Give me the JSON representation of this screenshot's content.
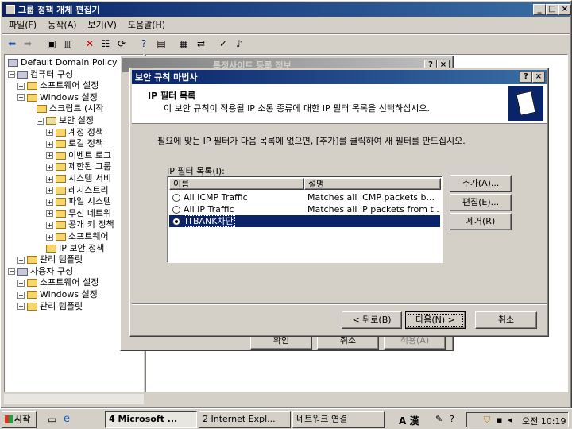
{
  "main_window": {
    "title": "그룹 정책 개체 편집기",
    "menu": [
      "파일(F)",
      "동작(A)",
      "보기(V)",
      "도움말(H)"
    ],
    "tree": [
      {
        "label": "Default Domain Policy [I",
        "level": 0
      },
      {
        "label": "컴퓨터 구성",
        "level": 0
      },
      {
        "label": "소프트웨어 설정",
        "level": 1
      },
      {
        "label": "Windows 설정",
        "level": 1
      },
      {
        "label": "스크립트 (시작",
        "level": 2
      },
      {
        "label": "보안 설정",
        "level": 2
      },
      {
        "label": "계정 정책",
        "level": 3
      },
      {
        "label": "로컬 정책",
        "level": 3
      },
      {
        "label": "이벤트 로그",
        "level": 3
      },
      {
        "label": "제한된 그룹",
        "level": 3
      },
      {
        "label": "시스템 서비",
        "level": 3
      },
      {
        "label": "레지스트리",
        "level": 3
      },
      {
        "label": "파일 시스템",
        "level": 3
      },
      {
        "label": "무선 네트워",
        "level": 3
      },
      {
        "label": "공개 키 정책",
        "level": 3
      },
      {
        "label": "소프트웨어",
        "level": 3
      },
      {
        "label": "IP 보안 정책",
        "level": 3
      },
      {
        "label": "관리 템플릿",
        "level": 1
      },
      {
        "label": "사용자 구성",
        "level": 0
      },
      {
        "label": "소프트웨어 설정",
        "level": 1
      },
      {
        "label": "Windows 설정",
        "level": 1
      },
      {
        "label": "관리 템플릿",
        "level": 1
      }
    ]
  },
  "background_dialog": {
    "title": "특정사이트 등록 정보",
    "buttons": [
      "확인",
      "취소",
      "적용(A)"
    ]
  },
  "wizard": {
    "title": "보안 규칙 마법사",
    "header_title": "IP 필터 목록",
    "header_subtitle": "이 보안 규칙이 적용될 IP 소통 종류에 대한 IP 필터 목록을 선택하십시오.",
    "instruction": "필요에 맞는 IP 필터가 다음 목록에 없으면, [추가]를 클릭하여 새 필터를 만드십시오.",
    "list_label": "IP 필터 목록(I):",
    "columns": [
      "이름",
      "설명"
    ],
    "rows": [
      {
        "name": "All ICMP Traffic",
        "desc": "Matches all ICMP packets b...",
        "selected": false
      },
      {
        "name": "All IP Traffic",
        "desc": "Matches all IP packets from t...",
        "selected": false
      },
      {
        "name": "ITBANK차단",
        "desc": "",
        "selected": true
      }
    ],
    "side_buttons": [
      "추가(A)...",
      "편집(E)...",
      "제거(R)"
    ],
    "back_label": "< 뒤로(B)",
    "next_label": "다음(N) >",
    "cancel_label": "취소"
  },
  "taskbar": {
    "start_label": "시작",
    "items": [
      "4 Microsoft ...",
      "2 Internet Expl...",
      "네트워크 연결"
    ],
    "tray_text": "A 漢",
    "clock": "오전 10:19"
  },
  "colors": {
    "desktop": "#3a6ea5",
    "titlebar": "#0a246a",
    "face": "#d4d0c8",
    "selection": "#0a246a"
  }
}
